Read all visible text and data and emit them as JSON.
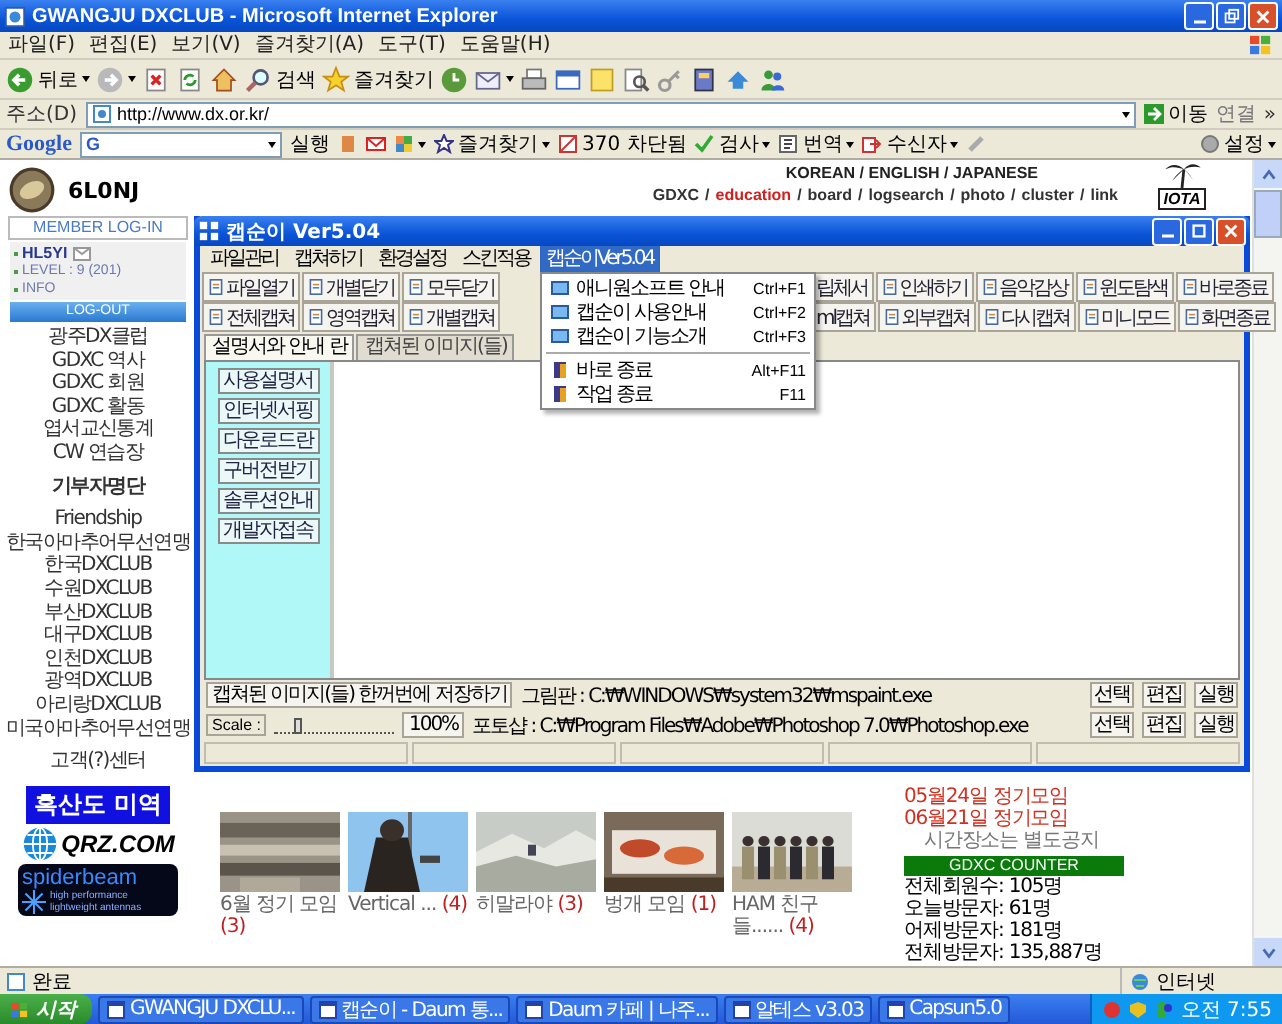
{
  "browser": {
    "title": "GWANGJU DXCLUB - Microsoft Internet Explorer",
    "menu": [
      "파일(F)",
      "편집(E)",
      "보기(V)",
      "즐겨찾기(A)",
      "도구(T)",
      "도움말(H)"
    ],
    "toolbar": [
      {
        "kind": "back",
        "label": "뒤로"
      },
      {
        "kind": "forward"
      },
      {
        "kind": "stop"
      },
      {
        "kind": "refresh"
      },
      {
        "kind": "home"
      },
      {
        "kind": "search",
        "label": "검색"
      },
      {
        "kind": "favorites",
        "label": "즐겨찾기"
      },
      {
        "kind": "history"
      },
      {
        "kind": "mail"
      },
      {
        "kind": "print"
      },
      {
        "kind": "edit"
      },
      {
        "kind": "note"
      },
      {
        "kind": "research"
      },
      {
        "kind": "key"
      },
      {
        "kind": "book"
      },
      {
        "kind": "messenger"
      },
      {
        "kind": "people"
      }
    ],
    "address": {
      "label": "주소(D)",
      "value": "http://www.dx.or.kr/",
      "go": "이동",
      "links": "연결",
      "more": "»"
    },
    "google_bar": [
      {
        "kind": "logo",
        "label": "Google"
      },
      {
        "kind": "field",
        "label": "G"
      },
      {
        "kind": "run",
        "label": "실행"
      },
      {
        "kind": "bookmark"
      },
      {
        "kind": "mail"
      },
      {
        "kind": "addons"
      },
      {
        "kind": "favorites",
        "label": "즐겨찾기"
      },
      {
        "kind": "blocked",
        "label": "370 차단됨"
      },
      {
        "kind": "check",
        "label": "검사"
      },
      {
        "kind": "translate",
        "label": "번역"
      },
      {
        "kind": "send",
        "label": "수신자"
      },
      {
        "kind": "pencil"
      },
      {
        "kind": "settings",
        "label": "설정"
      }
    ],
    "status": {
      "text": "완료",
      "zone": "인터넷"
    }
  },
  "site": {
    "callsign": "6L0NJ",
    "login_title": "MEMBER LOG-IN",
    "user": "HL5YI",
    "level": "LEVEL : 9 (201)",
    "info": "INFO",
    "logout": "LOG-OUT",
    "nav_groups": [
      {
        "items": [
          {
            "label": "광주DX클럽",
            "bold": false
          },
          {
            "label": "GDXC 역사",
            "bold": false
          },
          {
            "label": "GDXC 회원",
            "bold": false
          },
          {
            "label": "GDXC 활동",
            "bold": false
          },
          {
            "label": "엽서교신통계",
            "bold": false
          },
          {
            "label": "CW 연습장",
            "bold": false
          }
        ]
      },
      {
        "items": [
          {
            "label": "기부자명단",
            "bold": true
          }
        ]
      },
      {
        "items": [
          {
            "label": "Friendship",
            "bold": false
          },
          {
            "label": "한국아마추어무선연맹",
            "bold": false
          },
          {
            "label": "한국DXCLUB",
            "bold": false
          },
          {
            "label": "수원DXCLUB",
            "bold": false
          },
          {
            "label": "부산DXCLUB",
            "bold": false
          },
          {
            "label": "대구DXCLUB",
            "bold": false
          },
          {
            "label": "인천DXCLUB",
            "bold": false
          },
          {
            "label": "광역DXCLUB",
            "bold": false
          },
          {
            "label": "아리랑DXCLUB",
            "bold": false
          },
          {
            "label": "미국아마추어무선연맹",
            "bold": false
          }
        ]
      },
      {
        "items": [
          {
            "label": "고객(?)센터",
            "bold": false
          }
        ]
      }
    ],
    "banners": [
      {
        "kind": "seaweed",
        "label": "흑산도 미역"
      },
      {
        "kind": "qrz",
        "label": "QRZ.COM"
      },
      {
        "kind": "spiderbeam",
        "label": "spiderbeam",
        "sub": "high performance lightweight antennas"
      }
    ],
    "languages": "KOREAN / ENGLISH / JAPANESE",
    "nav_separator": "/",
    "nav": [
      {
        "label": "GDXC",
        "selected": false
      },
      {
        "label": "education",
        "selected": true
      },
      {
        "label": "board",
        "selected": false
      },
      {
        "label": "logsearch",
        "selected": false
      },
      {
        "label": "photo",
        "selected": false
      },
      {
        "label": "cluster",
        "selected": false
      },
      {
        "label": "link",
        "selected": false
      }
    ],
    "iota_logo": "IOTA",
    "photos": [
      {
        "kind": "picture",
        "caption": "6월 정기 모임",
        "count": "(3)"
      },
      {
        "kind": "picture",
        "caption": "Vertical ...",
        "count": "(4)"
      },
      {
        "kind": "picture",
        "caption": "히말라야",
        "count": "(3)"
      },
      {
        "kind": "picture",
        "caption": "벙개 모임",
        "count": "(1)"
      },
      {
        "kind": "picture",
        "caption": "HAM 친구들......",
        "count": "(4)"
      }
    ],
    "schedule": [
      "05월24일 정기모임",
      "06월21일 정기모임"
    ],
    "notice": "시간장소는 별도공지",
    "counter": {
      "title": "GDXC COUNTER",
      "lines": [
        "전체회원수: 105명",
        "오늘방문자: 61명",
        "어제방문자: 181명",
        "전체방문자: 135,887명"
      ]
    }
  },
  "app": {
    "title": "캡순이 Ver5.04",
    "menu": [
      {
        "label": "파일관리",
        "selected": false
      },
      {
        "label": "캡쳐하기",
        "selected": false
      },
      {
        "label": "환경설정",
        "selected": false
      },
      {
        "label": "스킨적용",
        "selected": false
      },
      {
        "label": "캡순이Ver5.04",
        "selected": true
      }
    ],
    "dropdown": [
      [
        {
          "label": "애니원소프트 안내",
          "shortcut": "Ctrl+F1"
        },
        {
          "label": "캡순이 사용안내",
          "shortcut": "Ctrl+F2"
        },
        {
          "label": "캡순이 기능소개",
          "shortcut": "Ctrl+F3"
        }
      ],
      [
        {
          "label": "바로 종료",
          "shortcut": "Alt+F11"
        },
        {
          "label": "작업 종료",
          "shortcut": "F11"
        }
      ]
    ],
    "toolbar_rows": [
      [
        {
          "kind": "button",
          "label": "파일열기"
        },
        {
          "kind": "button",
          "label": "개별닫기"
        },
        {
          "kind": "button",
          "label": "모두닫기"
        },
        {
          "kind": "cut",
          "label": "립체서"
        },
        {
          "kind": "button",
          "label": "인쇄하기"
        },
        {
          "kind": "button",
          "label": "음악감상"
        },
        {
          "kind": "button",
          "label": "윈도탐색"
        },
        {
          "kind": "button",
          "label": "바로종료"
        }
      ],
      [
        {
          "kind": "button",
          "label": "전체캡쳐"
        },
        {
          "kind": "button",
          "label": "영역캡쳐"
        },
        {
          "kind": "button",
          "label": "개별캡쳐"
        },
        {
          "kind": "cut",
          "label": "ml캡쳐"
        },
        {
          "kind": "button",
          "label": "외부캡쳐"
        },
        {
          "kind": "button",
          "label": "다시캡쳐"
        },
        {
          "kind": "button",
          "label": "미니모드"
        },
        {
          "kind": "button",
          "label": "화면종료"
        }
      ]
    ],
    "tabs": [
      {
        "label": "설명서와 안내 란",
        "selected": true
      },
      {
        "label": "캡쳐된 이미지(들)",
        "selected": false
      }
    ],
    "side_buttons": [
      "사용설명서",
      "인터넷서핑",
      "다운로드란",
      "구버전받기",
      "솔루션안내",
      "개발자접속"
    ],
    "save_button": "캡쳐된 이미지(들) 한꺼번에 저장하기",
    "scale": {
      "label": "Scale :",
      "level": 0.2,
      "value": "100%"
    },
    "programs": [
      {
        "path": "그림판 : C:₩WINDOWS₩system32₩mspaint.exe",
        "buttons": [
          "선택",
          "편집",
          "실행"
        ]
      },
      {
        "path": "포토샵 : C:₩Program Files₩Adobe₩Photoshop 7.0₩Photoshop.exe",
        "buttons": [
          "선택",
          "편집",
          "실행"
        ]
      }
    ]
  },
  "taskbar": {
    "start": "시작",
    "tasks": [
      "GWANGJU DXCLU...",
      "캡순이 - Daum 통...",
      "Daum 카페 | 나주...",
      "알테스 v3.03",
      "Capsun5.0"
    ],
    "clock": "오전 7:55"
  }
}
